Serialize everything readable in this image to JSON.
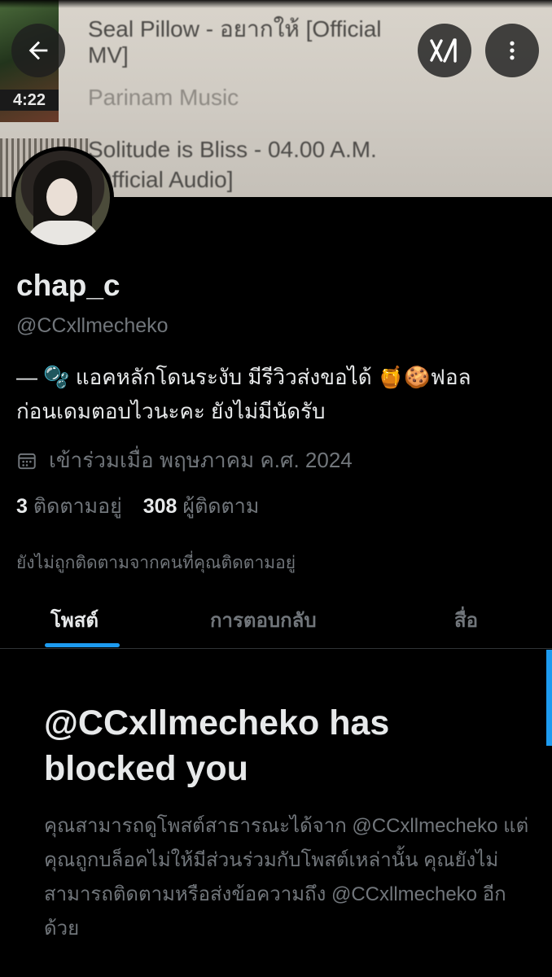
{
  "banner": {
    "video1_title_line1": "Seal Pillow - อยากให้ [Official",
    "video1_title_line2": "MV]",
    "video1_duration": "4:22",
    "video1_channel": "Parinam Music",
    "video2_title_line1": "Solitude is Bliss - 04.00 A.M.",
    "video2_title_line2": "[Official Audio]"
  },
  "header": {
    "back_icon": "arrow-left-icon",
    "xai_label": "x/",
    "more_icon": "more-vertical-icon"
  },
  "profile": {
    "display_name": "chap_c",
    "handle": "@CCxllmecheko",
    "bio_line1": "— 🫧 แอคหลักโดนระงับ มีรีวิวส่งขอได้ 🍯🍪ฟอล",
    "bio_line2": "ก่อนเดมตอบไวนะคะ ยังไม่มีนัดรับ",
    "joined": "เข้าร่วมเมื่อ พฤษภาคม ค.ศ. 2024",
    "following_count": "3",
    "following_label": "ติดตามอยู่",
    "followers_count": "308",
    "followers_label": "ผู้ติดตาม",
    "not_followed_note": "ยังไม่ถูกติดตามจากคนที่คุณติดตามอยู่"
  },
  "tabs": [
    {
      "label": "โพสต์",
      "active": true
    },
    {
      "label": "การตอบกลับ",
      "active": false
    },
    {
      "label": "สื่อ",
      "active": false
    }
  ],
  "blocked": {
    "title": "@CCxllmecheko has blocked you",
    "body": "คุณสามารถดูโพสต์สาธารณะได้จาก @CCxllmecheko แต่คุณถูกบล็อคไม่ให้มีส่วนร่วมกับโพสต์เหล่านั้น คุณยังไม่สามารถติดตามหรือส่งข้อความถึง @CCxllmecheko อีกด้วย"
  },
  "colors": {
    "background": "#000000",
    "primary_text": "#e7e9ea",
    "secondary_text": "#71767b",
    "accent": "#1d9bf0"
  }
}
